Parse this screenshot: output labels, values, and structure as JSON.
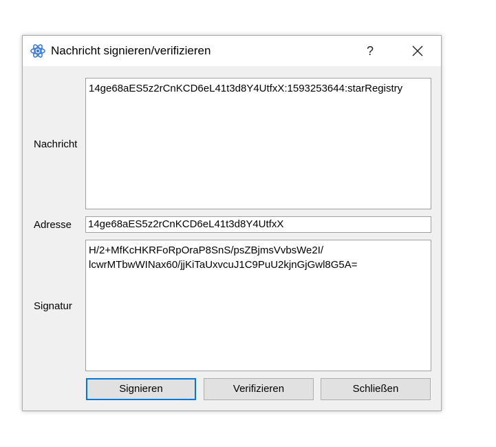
{
  "window": {
    "title": "Nachricht signieren/verifizieren",
    "help_label": "?",
    "icon": "atom-app-icon",
    "close_icon": "close-icon"
  },
  "form": {
    "message": {
      "label": "Nachricht",
      "value": "14ge68aES5z2rCnKCD6eL41t3d8Y4UtfxX:1593253644:starRegistry"
    },
    "address": {
      "label": "Adresse",
      "value": "14ge68aES5z2rCnKCD6eL41t3d8Y4UtfxX"
    },
    "signature": {
      "label": "Signatur",
      "value": "H/2+MfKcHKRFoRpOraP8SnS/psZBjmsVvbsWe2I/\nlcwrMTbwWINax60/jjKiTaUxvcuJ1C9PuU2kjnGjGwl8G5A="
    }
  },
  "buttons": {
    "sign_label": "Signieren",
    "verify_label": "Verifizieren",
    "close_label": "Schließen"
  },
  "colors": {
    "accent": "#0078d7",
    "dialog_background": "#f0f0f0",
    "icon_blue": "#3a7bd5"
  }
}
